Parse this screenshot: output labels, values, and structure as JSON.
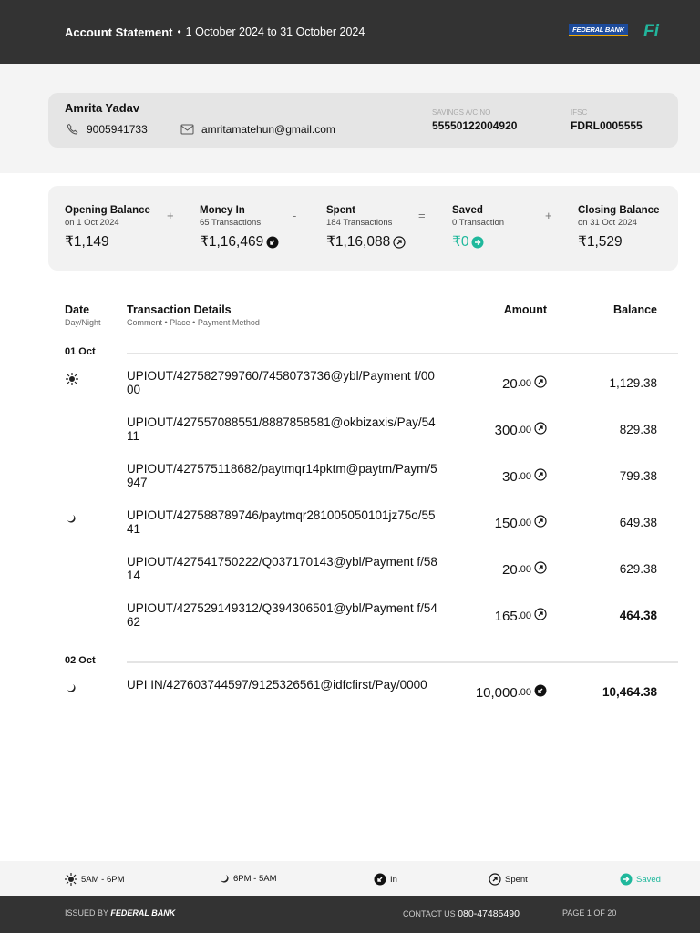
{
  "header": {
    "title": "Account Statement",
    "range": "1 October 2024  to  31 October 2024",
    "bank_logo": "FEDERAL BANK",
    "app_logo": "Fi"
  },
  "account": {
    "name": "Amrita Yadav",
    "phone": "9005941733",
    "email": "amritamatehun@gmail.com",
    "acct_label": "SAVINGS A/C NO",
    "acct_no": "55550122004920",
    "ifsc_label": "IFSC",
    "ifsc": "FDRL0005555"
  },
  "summary": {
    "opening": {
      "label": "Opening Balance",
      "sub": "on 1 Oct 2024",
      "amount": "₹1,149"
    },
    "money_in": {
      "label": "Money In",
      "sub": "65 Transactions",
      "amount": "₹1,16,469"
    },
    "spent": {
      "label": "Spent",
      "sub": "184 Transactions",
      "amount": "₹1,16,088"
    },
    "saved": {
      "label": "Saved",
      "sub": "0 Transaction",
      "amount": "₹0"
    },
    "closing": {
      "label": "Closing Balance",
      "sub": "on 31 Oct 2024",
      "amount": "₹1,529"
    },
    "ops": [
      "+",
      "-",
      "=",
      "+"
    ]
  },
  "colors": {
    "saved": "#1fb89c",
    "dark": "#333333"
  },
  "table": {
    "date": "Date",
    "date_sub": "Day/Night",
    "details": "Transaction Details",
    "details_sub": "Comment • Place • Payment Method",
    "amount": "Amount",
    "balance": "Balance"
  },
  "groups": [
    {
      "date": "01 Oct",
      "rows": [
        {
          "time": "sun",
          "details": "UPIOUT/427582799760/7458073736@ybl/Payment f/0000",
          "amount": "20",
          "dec": ".00",
          "type": "spent",
          "balance": "1,129.38",
          "bold": false
        },
        {
          "time": "",
          "details": "UPIOUT/427557088551/8887858581@okbizaxis/Pay/5411",
          "amount": "300",
          "dec": ".00",
          "type": "spent",
          "balance": "829.38",
          "bold": false
        },
        {
          "time": "",
          "details": "UPIOUT/427575118682/paytmqr14pktm@paytm/Paym/5947",
          "amount": "30",
          "dec": ".00",
          "type": "spent",
          "balance": "799.38",
          "bold": false
        },
        {
          "time": "moon",
          "details": "UPIOUT/427588789746/paytmqr281005050101jz75o/5541",
          "amount": "150",
          "dec": ".00",
          "type": "spent",
          "balance": "649.38",
          "bold": false
        },
        {
          "time": "",
          "details": "UPIOUT/427541750222/Q037170143@ybl/Payment f/5814",
          "amount": "20",
          "dec": ".00",
          "type": "spent",
          "balance": "629.38",
          "bold": false
        },
        {
          "time": "",
          "details": "UPIOUT/427529149312/Q394306501@ybl/Payment f/5462",
          "amount": "165",
          "dec": ".00",
          "type": "spent",
          "balance": "464.38",
          "bold": true
        }
      ]
    },
    {
      "date": "02 Oct",
      "rows": [
        {
          "time": "moon",
          "details": "UPI IN/427603744597/9125326561@idfcfirst/Pay/0000",
          "amount": "10,000",
          "dec": ".00",
          "type": "in",
          "balance": "10,464.38",
          "bold": true
        }
      ]
    }
  ],
  "legend": {
    "day": "5AM - 6PM",
    "night": "6PM - 5AM",
    "in": "In",
    "spent": "Spent",
    "saved": "Saved"
  },
  "footer": {
    "issued": "ISSUED BY",
    "bank": "FEDERAL BANK",
    "contact_label": "CONTACT US",
    "contact": "080-47485490",
    "page": "PAGE 1 OF 20"
  }
}
